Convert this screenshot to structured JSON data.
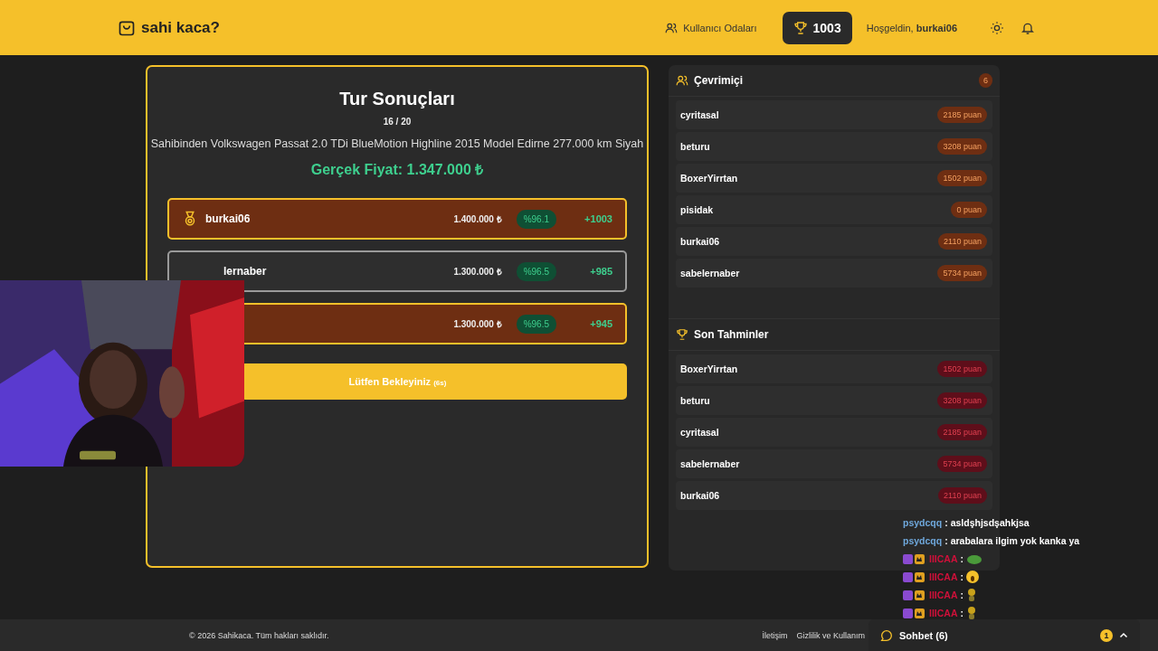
{
  "header": {
    "logo": "sahi kaca?",
    "rooms_link": "Kullanıcı Odaları",
    "score": "1003",
    "greeting": "Hoşgeldin, **burkai06**"
  },
  "results": {
    "title": "Tur Sonuçları",
    "round": "16 / 20",
    "listing": "Sahibinden Volkswagen Passat 2.0 TDi BlueMotion Highline 2015 Model Edirne 277.000 km Siyah",
    "real_price": "Gerçek Fiyat: 1.347.000 ₺",
    "rows": [
      {
        "name": "burkai06",
        "highlighted": true,
        "guess": "1.400.000 ₺",
        "accuracy": "%96.1",
        "points": "+1003"
      },
      {
        "name": "lernaber",
        "highlighted": false,
        "guess": "1.300.000 ₺",
        "accuracy": "%96.5",
        "points": "+985"
      },
      {
        "highlighted": true,
        "guess": "1.300.000 ₺",
        "accuracy": "%96.5",
        "points": "+945"
      }
    ],
    "wait_button": {
      "label": "Lütfen Bekleyiniz",
      "countdown": "(6s)"
    }
  },
  "sidebar": [
    {
      "kind": "online",
      "title": "Çevrimiçi",
      "count": "6",
      "users": [
        {
          "name": "cyritasal",
          "points": "2185 puan"
        },
        {
          "name": "beturu",
          "points": "3208 puan"
        },
        {
          "name": "BoxerYirrtan",
          "points": "1502 puan"
        },
        {
          "name": "pisidak",
          "points": "0 puan"
        },
        {
          "name": "burkai06",
          "points": "2110 puan"
        },
        {
          "name": "sabelernaber",
          "points": "5734 puan"
        }
      ]
    },
    {
      "kind": "recent",
      "title": "Son Tahminler",
      "users": [
        {
          "name": "BoxerYirrtan",
          "points": "1502 puan"
        },
        {
          "name": "beturu",
          "points": "3208 puan"
        },
        {
          "name": "cyritasal",
          "points": "2185 puan"
        },
        {
          "name": "sabelernaber",
          "points": "5734 puan"
        },
        {
          "name": "burkai06",
          "points": "2110 puan"
        }
      ]
    }
  ],
  "footer": {
    "copyright": "© 2026 Sahikaca. Tüm hakları saklıdır.",
    "links": [
      "İletişim",
      "Gizlilik ve Kullanım"
    ]
  },
  "chat_widget": {
    "label": "Sohbet (6)",
    "unread": "1"
  },
  "stream_chat": [
    {
      "user": "psydcqq",
      "color": "#6fa8dc",
      "badges": false,
      "separator": ":",
      "kind": "text",
      "message": "asldşhjsdşahkjsa"
    },
    {
      "user": "psydcqq",
      "color": "#6fa8dc",
      "badges": false,
      "separator": ":",
      "kind": "text",
      "message": "arabalara ilgim yok kanka ya"
    },
    {
      "user": "IIICAA",
      "color": "#d0103a",
      "badges": true,
      "separator": ":",
      "kind": "frog"
    },
    {
      "user": "IIICAA",
      "color": "#d0103a",
      "badges": true,
      "separator": ":",
      "kind": "surprised"
    },
    {
      "user": "IIICAA",
      "color": "#d0103a",
      "badges": true,
      "separator": ":",
      "kind": "figure"
    },
    {
      "user": "IIICAA",
      "color": "#d0103a",
      "badges": true,
      "separator": ":",
      "kind": "figure"
    }
  ]
}
